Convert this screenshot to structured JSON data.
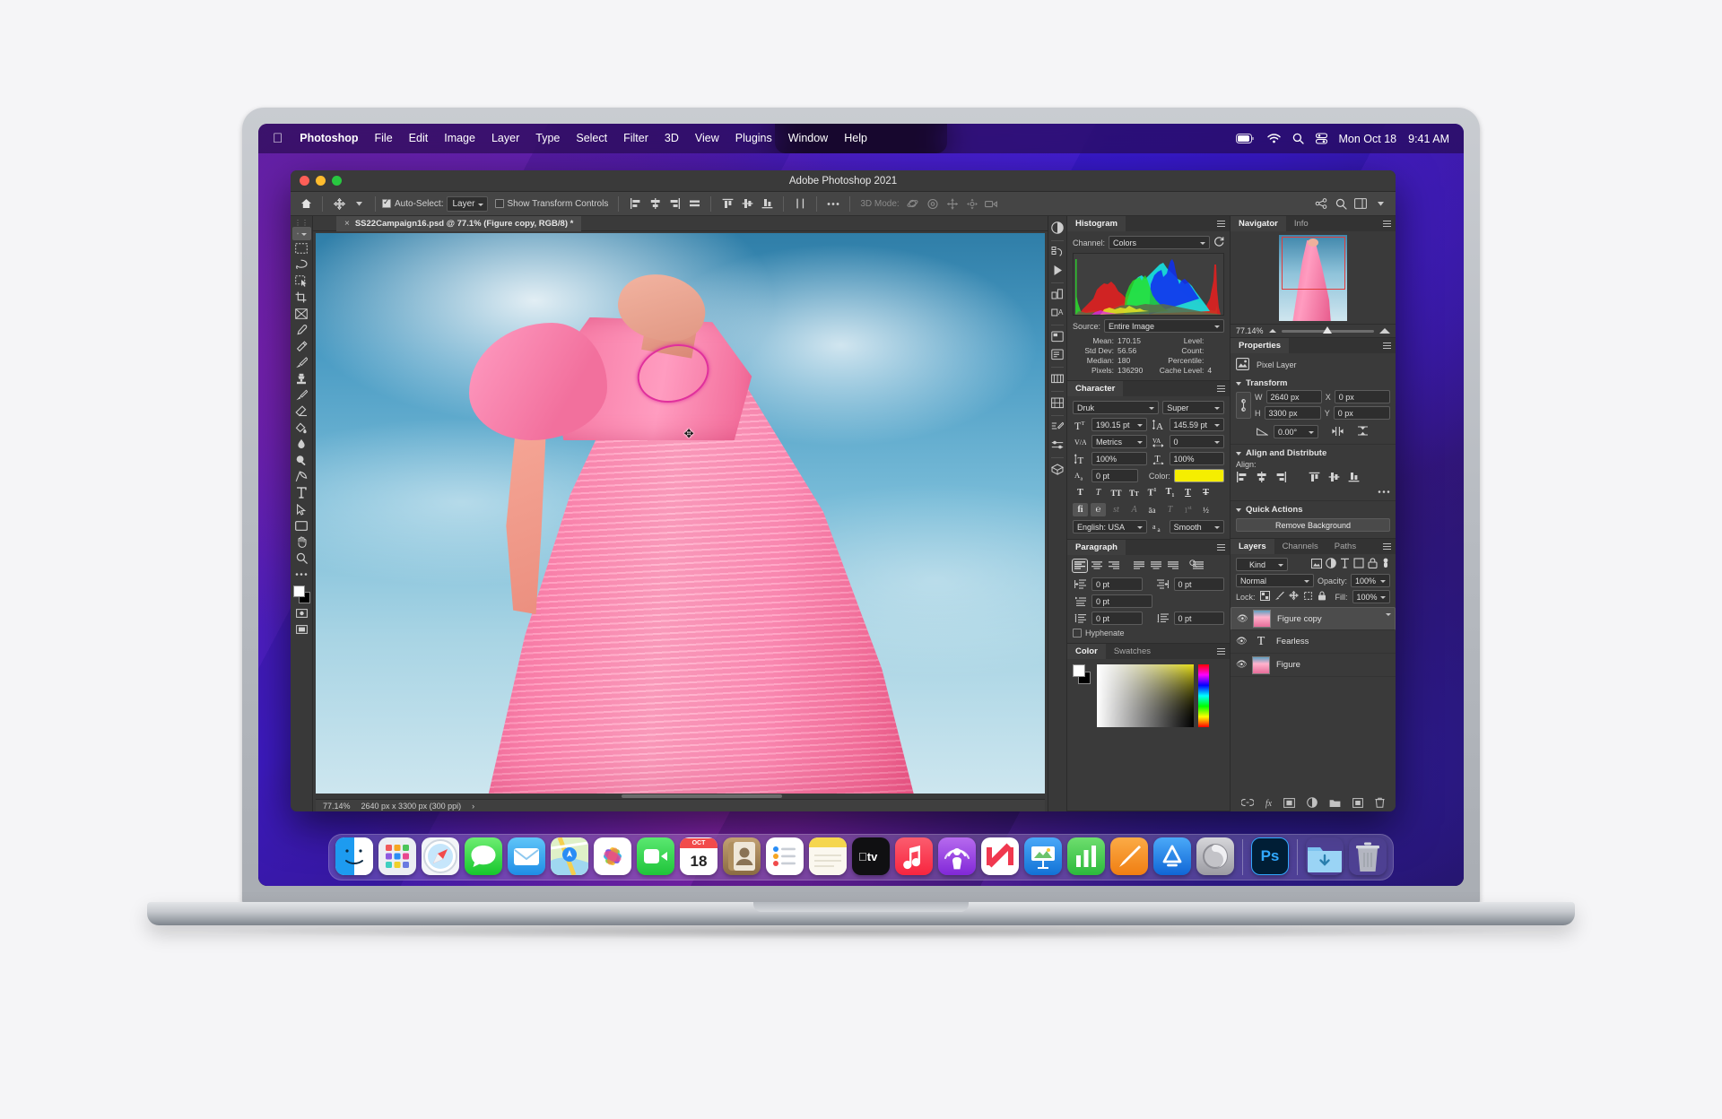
{
  "menubar": {
    "apple_icon": "apple-logo-icon",
    "items": [
      "Photoshop",
      "File",
      "Edit",
      "Image",
      "Layer",
      "Type",
      "Select",
      "Filter",
      "3D",
      "View",
      "Plugins",
      "Window",
      "Help"
    ],
    "status_icons": [
      "battery-icon",
      "wifi-icon",
      "search-icon",
      "control-center-icon"
    ],
    "date": "Mon Oct 18",
    "time": "9:41 AM"
  },
  "window": {
    "title": "Adobe Photoshop 2021",
    "traffic_lights": [
      "close-button",
      "minimize-button",
      "zoom-button"
    ]
  },
  "options_bar": {
    "home_icon": "home-icon",
    "tool_icon": "move-tool-icon",
    "auto_select_checked": true,
    "auto_select_label": "Auto-Select:",
    "auto_select_value": "Layer",
    "show_transform_checked": false,
    "show_transform_label": "Show Transform Controls",
    "align_icons": [
      "align-left-edges-icon",
      "align-horizontal-centers-icon",
      "align-right-edges-icon",
      "align-justify-icon"
    ],
    "distribute_icons": [
      "align-top-edges-icon",
      "align-vertical-centers-icon",
      "align-bottom-edges-icon",
      "distribute-icon"
    ],
    "more_icon": "ellipsis-icon",
    "three_d_label": "3D Mode:",
    "three_d_icons": [
      "orbit-3d-icon",
      "roll-3d-icon",
      "pan-3d-icon",
      "slide-3d-icon",
      "camera-3d-icon"
    ],
    "right_icons": [
      "share-icon",
      "search-icon",
      "arrange-icon",
      "workspace-chevron-icon"
    ]
  },
  "document": {
    "tab_title": "SS22Campaign16.psd @ 77.1% (Figure copy, RGB/8) *",
    "close_icon": "close-tab-icon"
  },
  "status_bar": {
    "zoom": "77.14%",
    "dimensions": "2640 px x 3300 px (300 ppi)",
    "chevron": "chevron-right-icon"
  },
  "toolbox": {
    "tools": [
      {
        "name": "move-tool",
        "selected": true
      },
      {
        "name": "rectangular-marquee-tool",
        "selected": false
      },
      {
        "name": "lasso-tool",
        "selected": false
      },
      {
        "name": "object-selection-tool",
        "selected": false
      },
      {
        "name": "crop-tool",
        "selected": false
      },
      {
        "name": "frame-tool",
        "selected": false
      },
      {
        "name": "eyedropper-tool",
        "selected": false
      },
      {
        "name": "spot-healing-brush-tool",
        "selected": false
      },
      {
        "name": "brush-tool",
        "selected": false
      },
      {
        "name": "clone-stamp-tool",
        "selected": false
      },
      {
        "name": "history-brush-tool",
        "selected": false
      },
      {
        "name": "eraser-tool",
        "selected": false
      },
      {
        "name": "gradient-tool",
        "selected": false
      },
      {
        "name": "blur-tool",
        "selected": false
      },
      {
        "name": "dodge-tool",
        "selected": false
      },
      {
        "name": "pen-tool",
        "selected": false
      },
      {
        "name": "type-tool",
        "selected": false
      },
      {
        "name": "path-selection-tool",
        "selected": false
      },
      {
        "name": "rectangle-tool",
        "selected": false
      },
      {
        "name": "hand-tool",
        "selected": false
      },
      {
        "name": "zoom-tool",
        "selected": false
      }
    ],
    "more_tools_icon": "more-tools-icon",
    "foreground_color": "#ffffff",
    "background_color": "#000000"
  },
  "histogram": {
    "tab": "Histogram",
    "channel_label": "Channel:",
    "channel_value": "Colors",
    "refresh_icon": "refresh-icon",
    "source_label": "Source:",
    "source_value": "Entire Image",
    "stats": [
      {
        "key": "Mean:",
        "value": "170.15",
        "key2": "Level:",
        "value2": ""
      },
      {
        "key": "Std Dev:",
        "value": "56.56",
        "key2": "Count:",
        "value2": ""
      },
      {
        "key": "Median:",
        "value": "180",
        "key2": "Percentile:",
        "value2": ""
      },
      {
        "key": "Pixels:",
        "value": "136290",
        "key2": "Cache Level:",
        "value2": "4"
      }
    ]
  },
  "character": {
    "tab": "Character",
    "font_family": "Druk",
    "font_style": "Super",
    "size_icon": "font-size-icon",
    "size": "190.15 pt",
    "leading_icon": "leading-icon",
    "leading": "145.59 pt",
    "kerning_icon": "kerning-icon",
    "kerning": "Metrics",
    "tracking_icon": "tracking-icon",
    "tracking": "0",
    "vscale_icon": "vertical-scale-icon",
    "vertical_scale": "100%",
    "hscale_icon": "horizontal-scale-icon",
    "horizontal_scale": "100%",
    "baseline_icon": "baseline-shift-icon",
    "baseline_shift": "0 pt",
    "color_label": "Color:",
    "color_value": "#f5ee00",
    "style_buttons": [
      "faux-bold-icon",
      "faux-italic-icon",
      "all-caps-icon",
      "small-caps-icon",
      "superscript-icon",
      "subscript-icon",
      "underline-icon",
      "strikethrough-icon"
    ],
    "opentype_buttons": [
      "standard-ligatures-icon",
      "contextual-alternates-icon",
      "discretionary-ligatures-icon",
      "swash-icon",
      "oldstyle-icon",
      "stylistic-alternates-icon",
      "ordinals-icon",
      "fractions-icon"
    ],
    "language": "English: USA",
    "antialias_icon": "anti-aliasing-icon",
    "antialias": "Smooth"
  },
  "paragraph": {
    "tab": "Paragraph",
    "align_buttons": [
      "align-left-icon",
      "align-center-icon",
      "align-right-icon",
      "justify-last-left-icon",
      "justify-last-center-icon",
      "justify-last-right-icon",
      "justify-all-icon"
    ],
    "indent_left_icon": "indent-left-margin-icon",
    "indent_left": "0 pt",
    "indent_right_icon": "indent-right-margin-icon",
    "indent_right": "0 pt",
    "indent_first_icon": "indent-first-line-icon",
    "indent_first": "0 pt",
    "space_before_icon": "space-before-paragraph-icon",
    "space_before": "0 pt",
    "space_after_icon": "space-after-paragraph-icon",
    "space_after": "0 pt",
    "hyphenate_label": "Hyphenate",
    "hyphenate_checked": false
  },
  "color_panel": {
    "tabs": [
      "Color",
      "Swatches"
    ],
    "active_tab": "Color",
    "foreground": "#ffffff",
    "background": "#000000"
  },
  "navigator": {
    "tabs": [
      "Navigator",
      "Info"
    ],
    "active_tab": "Navigator",
    "zoom": "77.14%",
    "zoom_out_icon": "zoom-out-icon",
    "zoom_in_icon": "zoom-in-icon"
  },
  "properties": {
    "tab": "Properties",
    "layer_type_icon": "pixel-layer-icon",
    "layer_type": "Pixel Layer",
    "transform": {
      "title": "Transform",
      "link_icon": "link-dimensions-icon",
      "w_label": "W",
      "w": "2640 px",
      "x_label": "X",
      "x": "0 px",
      "h_label": "H",
      "h": "3300 px",
      "y_label": "Y",
      "y": "0 px",
      "angle_icon": "rotate-angle-icon",
      "angle": "0.00°",
      "flip_h_icon": "flip-horizontal-icon",
      "flip_v_icon": "flip-vertical-icon"
    },
    "align": {
      "title": "Align and Distribute",
      "label": "Align:",
      "icons": [
        "align-left-edges-icon",
        "align-horizontal-centers-icon",
        "align-right-edges-icon",
        "align-top-edges-icon",
        "align-vertical-centers-icon",
        "align-bottom-edges-icon"
      ],
      "more_icon": "ellipsis-icon"
    },
    "quick_actions": {
      "title": "Quick Actions",
      "button": "Remove Background"
    }
  },
  "layers": {
    "tabs": [
      "Layers",
      "Channels",
      "Paths"
    ],
    "active_tab": "Layers",
    "filter_icon": "search-icon",
    "filter_value": "Kind",
    "filter_type_icons": [
      "pixel-filter-icon",
      "adjustment-filter-icon",
      "type-filter-icon",
      "shape-filter-icon",
      "smart-object-filter-icon"
    ],
    "filter_toggle_icon": "filter-toggle-icon",
    "blend_mode": "Normal",
    "opacity_label": "Opacity:",
    "opacity": "100%",
    "lock_label": "Lock:",
    "lock_icons": [
      "lock-transparent-pixels-icon",
      "lock-image-pixels-icon",
      "lock-position-icon",
      "lock-artboard-icon",
      "lock-all-icon"
    ],
    "fill_label": "Fill:",
    "fill": "100%",
    "items": [
      {
        "name": "Figure copy",
        "type": "image",
        "visible": true,
        "selected": true
      },
      {
        "name": "Fearless",
        "type": "text",
        "visible": true,
        "selected": false
      },
      {
        "name": "Figure",
        "type": "image",
        "visible": true,
        "selected": false
      }
    ],
    "footer_icons": [
      "link-layers-icon",
      "layer-styles-icon",
      "layer-mask-icon",
      "adjustment-layer-icon",
      "new-group-icon",
      "new-layer-icon",
      "delete-layer-icon"
    ]
  },
  "dock": {
    "apps": [
      {
        "name": "finder",
        "label": "",
        "color": "#1d9bf0",
        "running": true
      },
      {
        "name": "launchpad",
        "label": "",
        "color": "#e8e8ee",
        "running": false
      },
      {
        "name": "safari",
        "label": "",
        "color": "#f0f0f5",
        "running": false
      },
      {
        "name": "messages",
        "label": "",
        "color": "#45d65a",
        "running": false
      },
      {
        "name": "mail",
        "label": "",
        "color": "#3fa9f5",
        "running": false
      },
      {
        "name": "maps",
        "label": "",
        "color": "#8ad36a",
        "running": false
      },
      {
        "name": "photos",
        "label": "",
        "color": "#ffffff",
        "running": false
      },
      {
        "name": "facetime",
        "label": "",
        "color": "#3ecf5a",
        "running": false
      },
      {
        "name": "calendar",
        "label": "18",
        "color": "#ffffff",
        "running": false
      },
      {
        "name": "contacts",
        "label": "",
        "color": "#a6804f",
        "running": false
      },
      {
        "name": "reminders",
        "label": "",
        "color": "#ffffff",
        "running": false
      },
      {
        "name": "notes",
        "label": "",
        "color": "#fff4c2",
        "running": false
      },
      {
        "name": "appletv",
        "label": "tv",
        "color": "#111111",
        "running": false
      },
      {
        "name": "music",
        "label": "",
        "color": "#fb3b53",
        "running": false
      },
      {
        "name": "podcasts",
        "label": "",
        "color": "#9b4de0",
        "running": false
      },
      {
        "name": "news",
        "label": "",
        "color": "#ffffff",
        "running": false
      },
      {
        "name": "keynote",
        "label": "",
        "color": "#1f8df2",
        "running": false
      },
      {
        "name": "numbers",
        "label": "",
        "color": "#4cc55a",
        "running": false
      },
      {
        "name": "pages",
        "label": "",
        "color": "#f5932a",
        "running": false
      },
      {
        "name": "appstore",
        "label": "",
        "color": "#2a8df5",
        "running": false
      },
      {
        "name": "system-settings",
        "label": "",
        "color": "#b9b9bc",
        "running": false
      },
      {
        "name": "photoshop",
        "label": "Ps",
        "color": "#001e36",
        "running": true
      },
      {
        "name": "downloads-folder",
        "label": "",
        "color": "#7dc3ef",
        "running": false
      },
      {
        "name": "trash",
        "label": "",
        "color": "#9aa0a6",
        "running": false
      }
    ],
    "calendar_month": "OCT"
  }
}
